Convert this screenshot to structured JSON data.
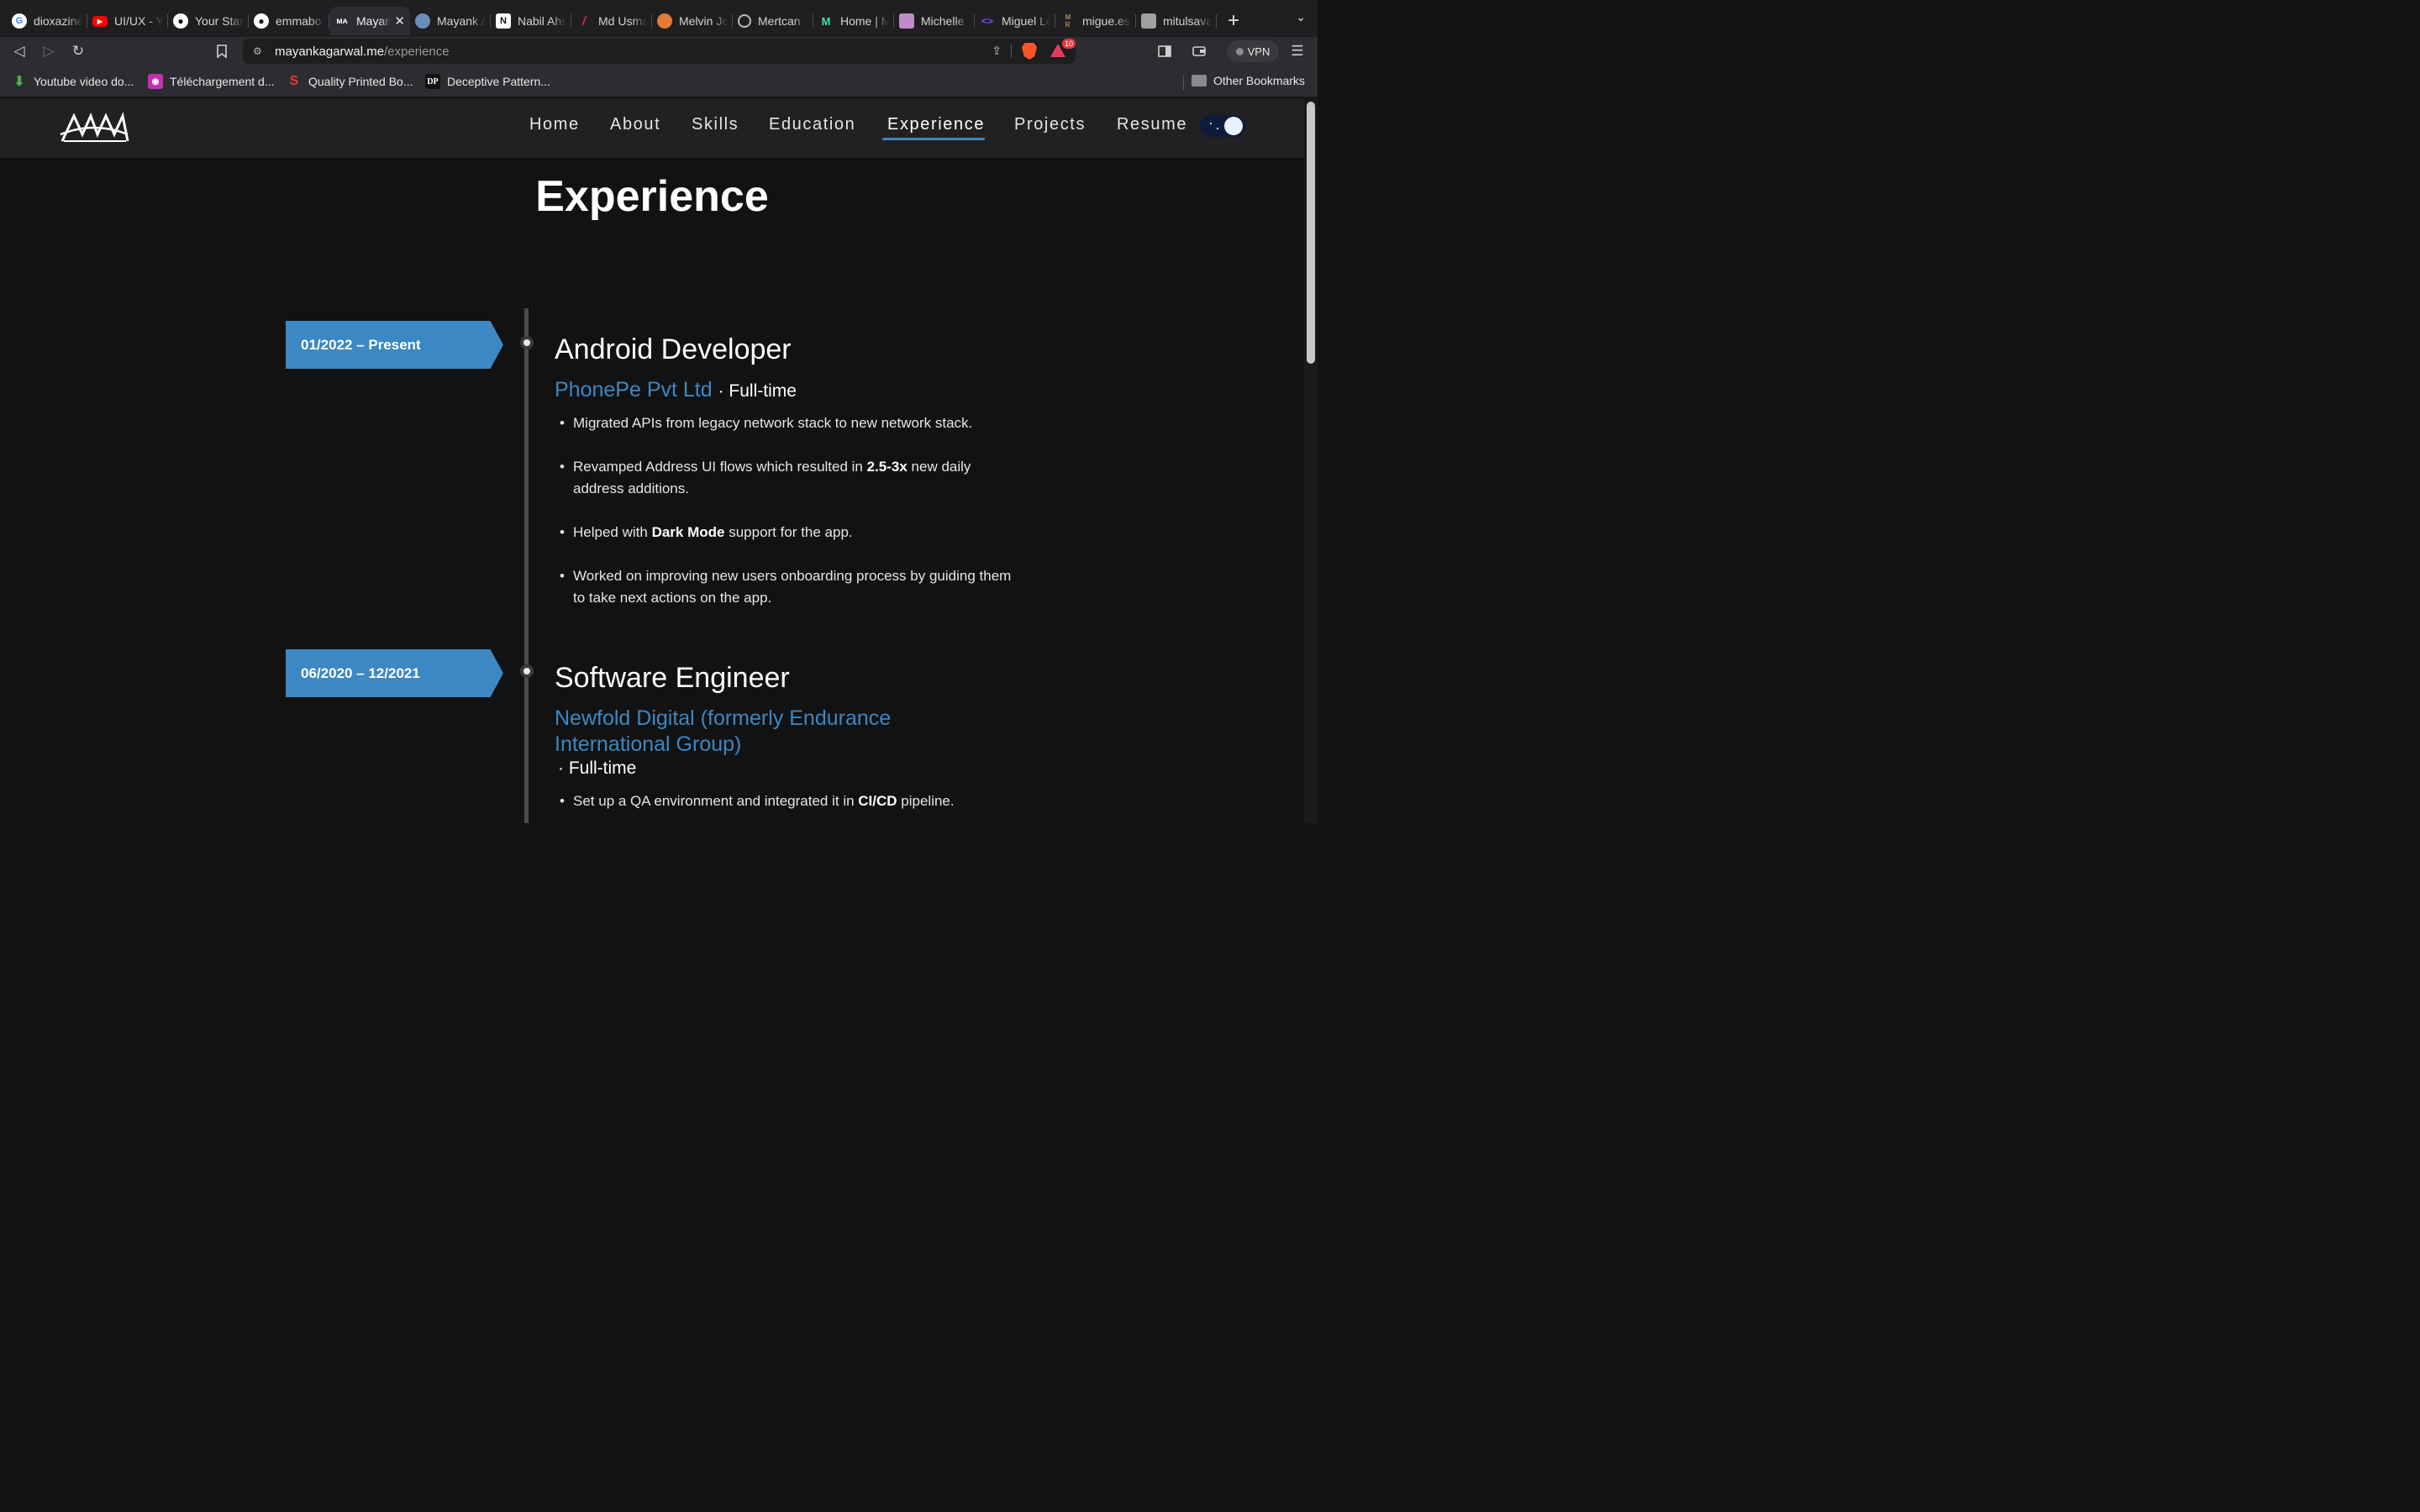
{
  "browser": {
    "tabs": [
      {
        "title": "dioxazine",
        "icon": "google-icon",
        "color": "#ffffff"
      },
      {
        "title": "UI/UX - YouTube",
        "icon": "youtube-icon",
        "color": "#ff0000"
      },
      {
        "title": "Your Stars",
        "icon": "github-icon",
        "color": "#ffffff"
      },
      {
        "title": "emmabostian",
        "icon": "github-icon",
        "color": "#ffffff"
      },
      {
        "title": "Mayank Agarwal",
        "icon": "ma-logo-icon",
        "color": "#ffffff",
        "active": true
      },
      {
        "title": "Mayank Agarwal",
        "icon": "avatar-icon",
        "color": "#6b8db5"
      },
      {
        "title": "Nabil Ahsan",
        "icon": "notion-icon",
        "color": "#ffffff"
      },
      {
        "title": "Md Usman",
        "icon": "slash-icon",
        "color": "#e0245e"
      },
      {
        "title": "Melvin Jose",
        "icon": "avatar-icon",
        "color": "#e07b39"
      },
      {
        "title": "Mertcan",
        "icon": "globe-icon",
        "color": "#bbbbbb"
      },
      {
        "title": "Home | M",
        "icon": "m-logo-icon",
        "color": "#40e0a0"
      },
      {
        "title": "Michelle",
        "icon": "avatar-icon",
        "color": "#c08cc8"
      },
      {
        "title": "Miguel Le",
        "icon": "code-icon",
        "color": "#7c4dff"
      },
      {
        "title": "migue.es",
        "icon": "mr-icon",
        "color": "#b08850"
      },
      {
        "title": "mitulsavani",
        "icon": "avatar-icon",
        "color": "#a0a0a0"
      }
    ],
    "url_host": "mayankagarwal.me",
    "url_path": "/experience",
    "rewards_count": "10",
    "vpn_label": "VPN",
    "bookmarks": [
      {
        "label": "Youtube video do...",
        "icon": "download-arrow-icon"
      },
      {
        "label": "Téléchargement d...",
        "icon": "app-icon"
      },
      {
        "label": "Quality Printed Bo...",
        "icon": "s-logo-icon"
      },
      {
        "label": "Deceptive Pattern...",
        "icon": "dp-logo-icon"
      }
    ],
    "other_bookmarks": "Other Bookmarks"
  },
  "nav": {
    "items": [
      "Home",
      "About",
      "Skills",
      "Education",
      "Experience",
      "Projects",
      "Resume"
    ],
    "active": "Experience"
  },
  "page_title": "Experience",
  "experiences": [
    {
      "date": "01/2022 – Present",
      "title": "Android Developer",
      "company": "PhonePe Pvt Ltd",
      "employment": "· Full-time",
      "bullets": [
        {
          "pre": "Migrated APIs from legacy network stack to new network stack.",
          "bold": "",
          "post": ""
        },
        {
          "pre": "Revamped Address UI flows which resulted in ",
          "bold": "2.5-3x",
          "post": " new daily address additions."
        },
        {
          "pre": "Helped with ",
          "bold": "Dark Mode",
          "post": " support for the app."
        },
        {
          "pre": "Worked on improving new users onboarding process by guiding them to take next actions on the app.",
          "bold": "",
          "post": ""
        }
      ]
    },
    {
      "date": "06/2020 – 12/2021",
      "title": "Software Engineer",
      "company": "Newfold Digital (formerly Endurance International Group)",
      "employment": "· Full-time",
      "bullets": [
        {
          "pre": "Set up a QA environment and integrated it in ",
          "bold": "CI/CD",
          "post": " pipeline."
        }
      ]
    }
  ],
  "colors": {
    "accent": "#3b88c4",
    "background": "#121212",
    "navbar": "#212124"
  }
}
